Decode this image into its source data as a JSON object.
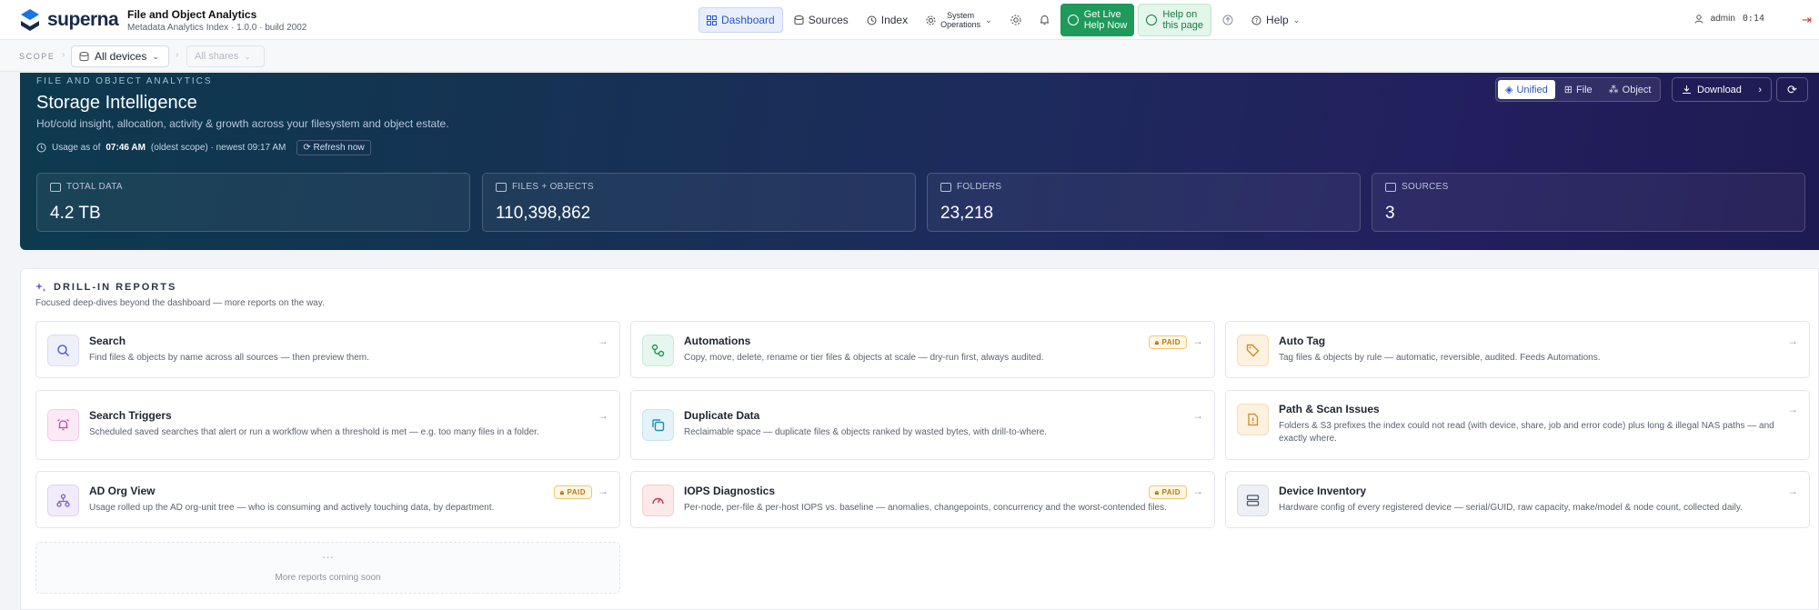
{
  "brand": {
    "logo_text": "superna",
    "app_name": "File and Object Analytics",
    "app_version": "Metadata Analytics Index · 1.0.0 · build 2002"
  },
  "nav": {
    "dashboard": "Dashboard",
    "sources": "Sources",
    "index": "Index",
    "system_operations_line1": "System",
    "system_operations_line2": "Operations",
    "get_live_help_line1": "Get Live",
    "get_live_help_line2": "Help Now",
    "help_page_line1": "Help on",
    "help_page_line2": "this page",
    "help": "Help"
  },
  "user": {
    "name": "admin",
    "session_timer": "0:14"
  },
  "scope": {
    "label": "SCOPE",
    "device": "All devices",
    "shares": "All shares"
  },
  "hero": {
    "kicker": "FILE AND OBJECT ANALYTICS",
    "title": "Storage Intelligence",
    "subtitle": "Hot/cold insight, allocation, activity & growth across your filesystem and object estate.",
    "usage_prefix": "Usage as of",
    "usage_time": "07:46 AM",
    "usage_suffix": "(oldest scope) · newest 09:17 AM",
    "refresh_label": "Refresh now",
    "view_modes": [
      "Unified",
      "File",
      "Object"
    ],
    "download_label": "Download",
    "stats": [
      {
        "label": "TOTAL DATA",
        "value": "4.2 TB"
      },
      {
        "label": "FILES + OBJECTS",
        "value": "110,398,862"
      },
      {
        "label": "FOLDERS",
        "value": "23,218"
      },
      {
        "label": "SOURCES",
        "value": "3"
      }
    ]
  },
  "reports": {
    "title": "DRILL-IN REPORTS",
    "subtitle": "Focused deep-dives beyond the dashboard — more reports on the way.",
    "paid_label": "PAID",
    "cards": [
      {
        "title": "Search",
        "desc": "Find files & objects by name across all sources — then preview them."
      },
      {
        "title": "Automations",
        "desc": "Copy, move, delete, rename or tier files & objects at scale — dry-run first, always audited."
      },
      {
        "title": "Auto Tag",
        "desc": "Tag files & objects by rule — automatic, reversible, audited. Feeds Automations."
      },
      {
        "title": "Search Triggers",
        "desc": "Scheduled saved searches that alert or run a workflow when a threshold is met — e.g. too many files in a folder."
      },
      {
        "title": "Duplicate Data",
        "desc": "Reclaimable space — duplicate files & objects ranked by wasted bytes, with drill-to-where."
      },
      {
        "title": "Path & Scan Issues",
        "desc": "Folders & S3 prefixes the index could not read (with device, share, job and error code) plus long & illegal NAS paths — and exactly where."
      },
      {
        "title": "AD Org View",
        "desc": "Usage rolled up the AD org-unit tree — who is consuming and actively touching data, by department."
      },
      {
        "title": "IOPS Diagnostics",
        "desc": "Per-node, per-file & per-host IOPS vs. baseline — anomalies, changepoints, concurrency and the worst-contended files."
      },
      {
        "title": "Device Inventory",
        "desc": "Hardware config of every registered device — serial/GUID, raw capacity, make/model & node count, collected daily."
      }
    ],
    "coming_soon": "More reports coming soon"
  }
}
